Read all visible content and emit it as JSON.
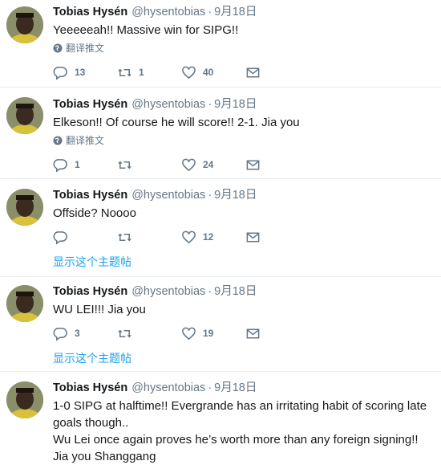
{
  "author": {
    "name": "Tobias Hysén",
    "handle": "@hysentobias"
  },
  "separator": "·",
  "translate_label": "翻译推文",
  "thread_label": "显示这个主题帖",
  "icons": [
    "reply-icon",
    "retweet-icon",
    "like-icon",
    "dm-icon",
    "globe-icon"
  ],
  "tweets": [
    {
      "date": "9月18日",
      "text": "Yeeeeeah!! Massive win for SIPG!!",
      "replies": "13",
      "retweets": "1",
      "likes": "40"
    },
    {
      "date": "9月18日",
      "text": "Elkeson!! Of course he will score!! 2-1. Jia you",
      "replies": "1",
      "retweets": "",
      "likes": "24"
    },
    {
      "date": "9月18日",
      "text": "Offside? Noooo",
      "replies": "",
      "retweets": "",
      "likes": "12"
    },
    {
      "date": "9月18日",
      "text": "WU LEI!!! Jia you",
      "replies": "3",
      "retweets": "",
      "likes": "19"
    },
    {
      "date": "9月18日",
      "text": "1-0 SIPG at halftime!! Evergrande has an irritating habit of scoring late goals though..\nWu Lei once again proves he’s worth more than any foreign signing!! Jia you Shanggang",
      "replies": "",
      "retweets": "",
      "likes": ""
    }
  ]
}
